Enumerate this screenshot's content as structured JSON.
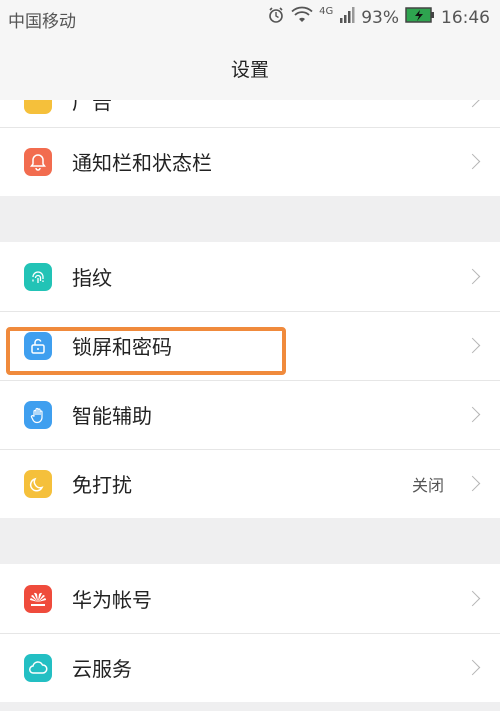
{
  "status_bar": {
    "carrier": "中国移动",
    "network": "4G",
    "battery": "93%",
    "time": "16:46"
  },
  "title": "设置",
  "sections": [
    {
      "items": [
        {
          "label": "广告",
          "icon": "partial-icon",
          "color": "#f5c03b",
          "partial": true
        },
        {
          "label": "通知栏和状态栏",
          "icon": "bell-icon",
          "color": "#f26c4f"
        }
      ]
    },
    {
      "items": [
        {
          "label": "指纹",
          "icon": "fingerprint-icon",
          "color": "#22c3b6"
        },
        {
          "label": "锁屏和密码",
          "icon": "unlock-icon",
          "color": "#3f9fef",
          "highlight": true
        },
        {
          "label": "智能辅助",
          "icon": "hand-icon",
          "color": "#3f9fef"
        },
        {
          "label": "免打扰",
          "icon": "moon-icon",
          "color": "#f5c03b",
          "value": "关闭"
        }
      ]
    },
    {
      "items": [
        {
          "label": "华为帐号",
          "icon": "huawei-icon",
          "color": "#ef4b3c"
        },
        {
          "label": "云服务",
          "icon": "cloud-icon",
          "color": "#23bfc3"
        }
      ]
    }
  ],
  "colors": {
    "highlight_border": "#f08a3c"
  }
}
